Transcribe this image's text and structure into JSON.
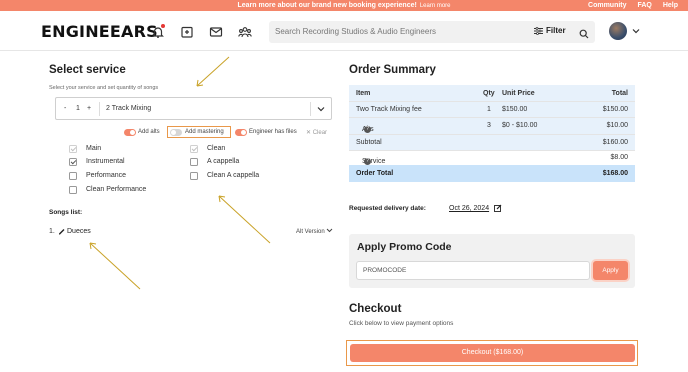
{
  "banner": {
    "message": "Learn more about our brand new booking experience!",
    "link": "Learn more",
    "links": [
      "Community",
      "FAQ",
      "Help"
    ]
  },
  "header": {
    "logo": "ENGINEEARS",
    "nav_icons": [
      "bell-icon",
      "folder-icon",
      "mail-icon",
      "people-icon"
    ],
    "search_placeholder": "Search Recording Studios & Audio Engineers",
    "filter_label": "Filter"
  },
  "service": {
    "title": "Select service",
    "subtitle": "Select your service and set quantity of songs",
    "qty_minus": "-",
    "qty_value": "1",
    "qty_plus": "+",
    "service_name": "2 Track Mixing",
    "toggles": [
      {
        "label": "Add alts",
        "on": true
      },
      {
        "label": "Add mastering",
        "on": false
      },
      {
        "label": "Engineer has files",
        "on": true
      }
    ],
    "clear_label": "Clear",
    "alts_left": [
      {
        "label": "Main",
        "checked": true,
        "disabled": true
      },
      {
        "label": "Instrumental",
        "checked": true,
        "disabled": false
      },
      {
        "label": "Performance",
        "checked": false,
        "disabled": false
      },
      {
        "label": "Clean Performance",
        "checked": false,
        "disabled": false
      }
    ],
    "alts_right": [
      {
        "label": "Clean",
        "checked": true,
        "disabled": true
      },
      {
        "label": "A cappella",
        "checked": false,
        "disabled": false
      },
      {
        "label": "Clean A cappella",
        "checked": false,
        "disabled": false
      }
    ]
  },
  "songs": {
    "title": "Songs list:",
    "items": [
      {
        "number": "1.",
        "name": "Dueces"
      }
    ],
    "alt_version_label": "Alt Version"
  },
  "order": {
    "title": "Order Summary",
    "headers": {
      "item": "Item",
      "qty": "Qty",
      "unit_price": "Unit Price",
      "total": "Total"
    },
    "rows": [
      {
        "item": "Two Track Mixing fee",
        "qty": "1",
        "unit_price": "$150.00",
        "total": "$150.00"
      },
      {
        "item": "Alts",
        "qty": "3",
        "unit_price": "$0 - $10.00",
        "total": "$10.00"
      }
    ],
    "subtotal_label": "Subtotal",
    "subtotal_value": "$160.00",
    "service_fee_label": "Service Fee",
    "service_fee_value": "$8.00",
    "total_label": "Order Total",
    "total_value": "$168.00"
  },
  "delivery": {
    "label": "Requested delivery date:",
    "date": "Oct 26, 2024"
  },
  "promo": {
    "title": "Apply Promo Code",
    "input_value": "PROMOCODE",
    "button_label": "Apply"
  },
  "checkout": {
    "title": "Checkout",
    "subtitle": "Click below to view payment options",
    "button_label": "Checkout ($168.00)"
  },
  "colors": {
    "accent": "#f4866a",
    "highlight_outline": "#e9984a",
    "arrow": "#c9a227",
    "summary_bg": "#e7f1fb",
    "total_bg": "#c9e3fa"
  }
}
